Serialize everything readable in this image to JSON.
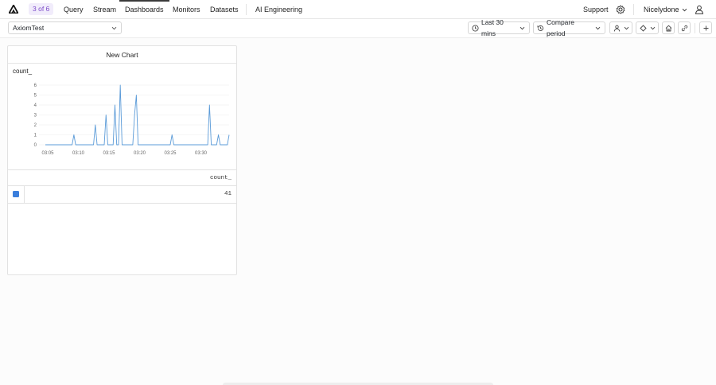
{
  "brand": {
    "logo_icon": "axiom-logo-icon"
  },
  "nav": {
    "badge": "3 of 6",
    "items": [
      {
        "label": "Query"
      },
      {
        "label": "Stream"
      },
      {
        "label": "Dashboards",
        "active": true
      },
      {
        "label": "Monitors"
      },
      {
        "label": "Datasets"
      },
      {
        "label": "AI Engineering"
      }
    ],
    "support": "Support",
    "settings_icon": "gear-icon",
    "user": "Nicelydone",
    "profile_icon": "user-icon"
  },
  "toolbar": {
    "dataset": "AxiomTest",
    "time_range": "Last 30 mins",
    "compare": "Compare period",
    "icons": [
      "clock-icon",
      "history-icon",
      "person-filter-icon",
      "diamond-icon",
      "home-icon",
      "link-icon",
      "plus-icon"
    ]
  },
  "panel": {
    "title": "New Chart",
    "series_label": "count_",
    "table": {
      "column": "count_",
      "rows": [
        {
          "value": "41"
        }
      ]
    }
  },
  "colors": {
    "accent": "#3b7fdc",
    "badge_bg": "#f1ecfb",
    "badge_text": "#7a49c8",
    "line": "#5b9bd8"
  },
  "chart_data": {
    "type": "line",
    "x_ticks": [
      "03:05",
      "03:10",
      "03:15",
      "03:20",
      "03:25",
      "03:30"
    ],
    "y_ticks": [
      "0",
      "1",
      "2",
      "3",
      "4",
      "5",
      "6"
    ],
    "ylim": [
      0,
      6
    ],
    "series": [
      {
        "name": "count_",
        "values": [
          0,
          0,
          0,
          0,
          0,
          0,
          0,
          0,
          0,
          0,
          0,
          0,
          0,
          0,
          0,
          0,
          1,
          0,
          0,
          0,
          0,
          0,
          0,
          0,
          0,
          0,
          0,
          0,
          2,
          0,
          0,
          0,
          0,
          0,
          3,
          0,
          0,
          0,
          0,
          4,
          0,
          0,
          6,
          0,
          0,
          0,
          0,
          0,
          0,
          0,
          3,
          5,
          0,
          0,
          0,
          0,
          0,
          0,
          0,
          0,
          0,
          0,
          0,
          0,
          0,
          0,
          0,
          0,
          0,
          0,
          0,
          1,
          0,
          0,
          0,
          0,
          0,
          0,
          0,
          0,
          0,
          0,
          0,
          0,
          0,
          0,
          0,
          0,
          0,
          0,
          0,
          0,
          4,
          0,
          0,
          0,
          0,
          1,
          0,
          0,
          0,
          0,
          0,
          1
        ]
      }
    ],
    "grid": true
  }
}
